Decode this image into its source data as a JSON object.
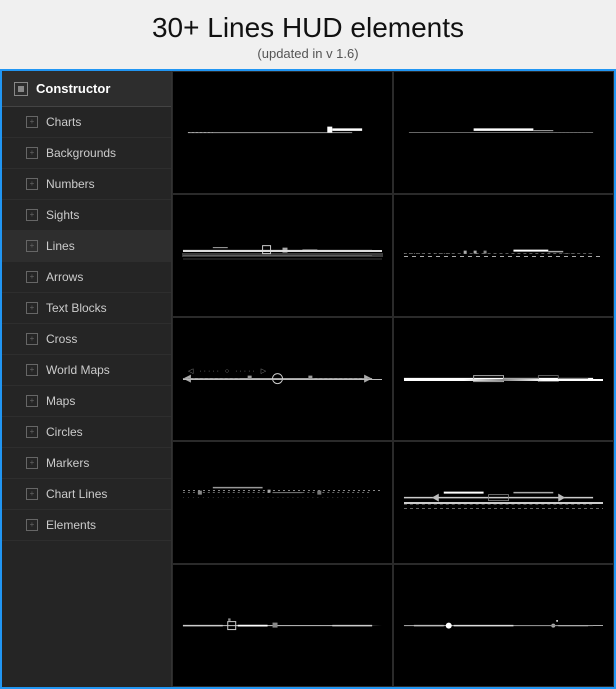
{
  "page": {
    "title": "30+ Lines HUD elements",
    "subtitle": "(updated in v 1.6)"
  },
  "sidebar": {
    "header": {
      "label": "Constructor",
      "icon": "constructor-icon"
    },
    "items": [
      {
        "id": "charts",
        "label": "Charts"
      },
      {
        "id": "backgrounds",
        "label": "Backgrounds"
      },
      {
        "id": "numbers",
        "label": "Numbers"
      },
      {
        "id": "sights",
        "label": "Sights"
      },
      {
        "id": "lines",
        "label": "Lines",
        "active": true
      },
      {
        "id": "arrows",
        "label": "Arrows"
      },
      {
        "id": "text-blocks",
        "label": "Text Blocks"
      },
      {
        "id": "cross",
        "label": "Cross"
      },
      {
        "id": "world-maps",
        "label": "World Maps"
      },
      {
        "id": "maps",
        "label": "Maps"
      },
      {
        "id": "circles",
        "label": "Circles"
      },
      {
        "id": "markers",
        "label": "Markers"
      },
      {
        "id": "chart-lines",
        "label": "Chart Lines"
      },
      {
        "id": "elements",
        "label": "Elements"
      }
    ]
  },
  "content": {
    "grid": {
      "cols": 2,
      "rows": 5
    },
    "cells": [
      {
        "id": "cell-1-1",
        "row": 1,
        "col": 1
      },
      {
        "id": "cell-1-2",
        "row": 1,
        "col": 2
      },
      {
        "id": "cell-2-1",
        "row": 2,
        "col": 1
      },
      {
        "id": "cell-2-2",
        "row": 2,
        "col": 2
      },
      {
        "id": "cell-3-1",
        "row": 3,
        "col": 1
      },
      {
        "id": "cell-3-2",
        "row": 3,
        "col": 2
      },
      {
        "id": "cell-4-1",
        "row": 4,
        "col": 1
      },
      {
        "id": "cell-4-2",
        "row": 4,
        "col": 2
      },
      {
        "id": "cell-5-1",
        "row": 5,
        "col": 1
      },
      {
        "id": "cell-5-2",
        "row": 5,
        "col": 2
      }
    ]
  }
}
